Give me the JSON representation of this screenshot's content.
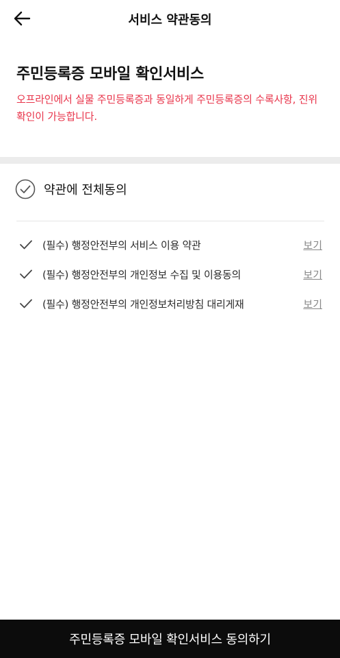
{
  "header": {
    "title": "서비스 약관동의",
    "back_icon": "arrow-left-icon"
  },
  "service": {
    "title": "주민등록증 모바일 확인서비스",
    "description": "오프라인에서 실물 주민등록증과 동일하게 주민등록증의 수록사항, 진위확인이 가능합니다.",
    "description_color": "#e8354b"
  },
  "agree_all": {
    "label": "약관에 전체동의",
    "icon": "circle-check-icon",
    "checked": false
  },
  "terms": [
    {
      "label": "(필수) 행정안전부의 서비스 이용 약관",
      "view": "보기",
      "checked": false
    },
    {
      "label": "(필수) 행정안전부의 개인정보 수집 및 이용동의",
      "view": "보기",
      "checked": false
    },
    {
      "label": "(필수) 행정안전부의 개인정보처리방침 대리게재",
      "view": "보기",
      "checked": false
    }
  ],
  "footer": {
    "button_label": "주민등록증 모바일 확인서비스 동의하기",
    "button_color": "#0c0c0c"
  }
}
